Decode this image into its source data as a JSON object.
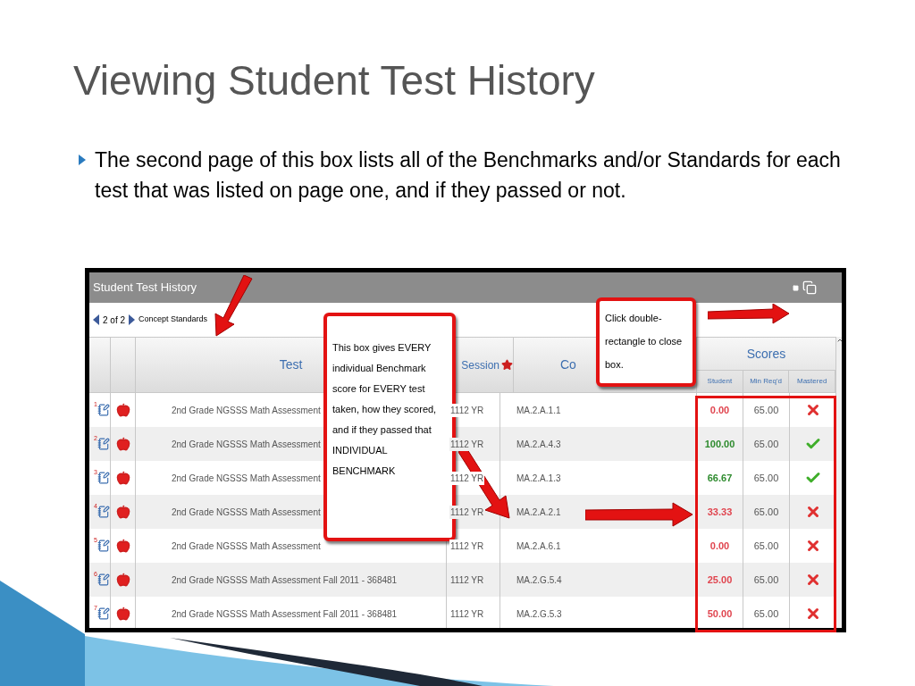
{
  "slide": {
    "title": "Viewing Student Test History",
    "bullets": [
      "The second page of this box lists all of the Benchmarks and/or Standards for each test that was listed on page one, and if they passed or not."
    ]
  },
  "window": {
    "title": "Student Test History",
    "page": "2 of 2",
    "section": "Concept Standards"
  },
  "table": {
    "columns": [
      "Test",
      "Session",
      "Co"
    ],
    "scores_group": "Scores",
    "score_columns": [
      "Student",
      "Min Req'd",
      "Mastered"
    ],
    "rows": [
      {
        "number": "1",
        "test": "2nd Grade NGSSS Math Assessment",
        "session": "1112 YR",
        "concept": "MA.2.A.1.1",
        "student": "0.00",
        "min": "65.00",
        "mastered": false
      },
      {
        "number": "2",
        "test": "2nd Grade NGSSS Math Assessment",
        "session": "1112 YR",
        "concept": "MA.2.A.4.3",
        "student": "100.00",
        "min": "65.00",
        "mastered": true
      },
      {
        "number": "3",
        "test": "2nd Grade NGSSS Math Assessment",
        "session": "1112 YR",
        "concept": "MA.2.A.1.3",
        "student": "66.67",
        "min": "65.00",
        "mastered": true
      },
      {
        "number": "4",
        "test": "2nd Grade NGSSS Math Assessment",
        "session": "1112 YR",
        "concept": "MA.2.A.2.1",
        "student": "33.33",
        "min": "65.00",
        "mastered": false
      },
      {
        "number": "5",
        "test": "2nd Grade NGSSS Math Assessment",
        "session": "1112 YR",
        "concept": "MA.2.A.6.1",
        "student": "0.00",
        "min": "65.00",
        "mastered": false
      },
      {
        "number": "6",
        "test": "2nd Grade NGSSS Math Assessment Fall 2011 - 368481",
        "session": "1112 YR",
        "concept": "MA.2.G.5.4",
        "student": "25.00",
        "min": "65.00",
        "mastered": false
      },
      {
        "number": "7",
        "test": "2nd Grade NGSSS Math Assessment Fall 2011 - 368481",
        "session": "1112 YR",
        "concept": "MA.2.G.5.3",
        "student": "50.00",
        "min": "65.00",
        "mastered": false
      }
    ]
  },
  "callouts": [
    {
      "text": "This box gives EVERY individual Benchmark score for EVERY test taken, how they scored, and if they passed that INDIVIDUAL BENCHMARK"
    },
    {
      "text": "Click double-rectangle to close box."
    }
  ]
}
